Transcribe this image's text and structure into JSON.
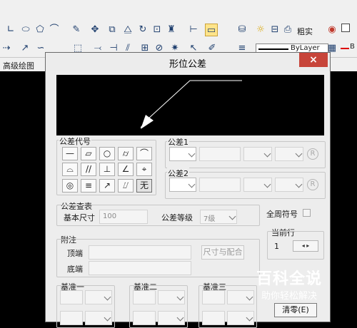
{
  "ribbon": {
    "panel_label": "高级绘图",
    "lineweight_label": "粗实",
    "linetype_value": "ByLayer",
    "truncated_text": "B"
  },
  "dialog": {
    "title": "形位公差",
    "close_symbol": "×",
    "symbol_group": {
      "label": "公差代号",
      "symbols": [
        "—",
        "▱",
        "○",
        "⌭",
        "⌒",
        "⌓",
        "//",
        "⊥",
        "∠",
        "⌖",
        "◎",
        "≡",
        "↗",
        "⌰",
        "无"
      ]
    },
    "tolerance1": {
      "label": "公差1",
      "r_symbol": "R"
    },
    "tolerance2": {
      "label": "公差2",
      "r_symbol": "R"
    },
    "lookup": {
      "label": "公差查表",
      "basic_size_label": "基本尺寸",
      "basic_size_value": "100",
      "grade_label": "公差等级",
      "grade_value": "7级"
    },
    "all_around_label": "全周符号",
    "current_row": {
      "label": "当前行",
      "value": "1",
      "prev": "◂",
      "next": "▸"
    },
    "note": {
      "label": "附注",
      "top_label": "顶端",
      "bottom_label": "底端",
      "size_match_button": "尺寸与配合"
    },
    "datums": [
      "基准一",
      "基准二",
      "基准三"
    ],
    "clear_button": "清零(E)"
  },
  "watermark": {
    "title": "百科全说",
    "subtitle": "助你轻松解决"
  }
}
